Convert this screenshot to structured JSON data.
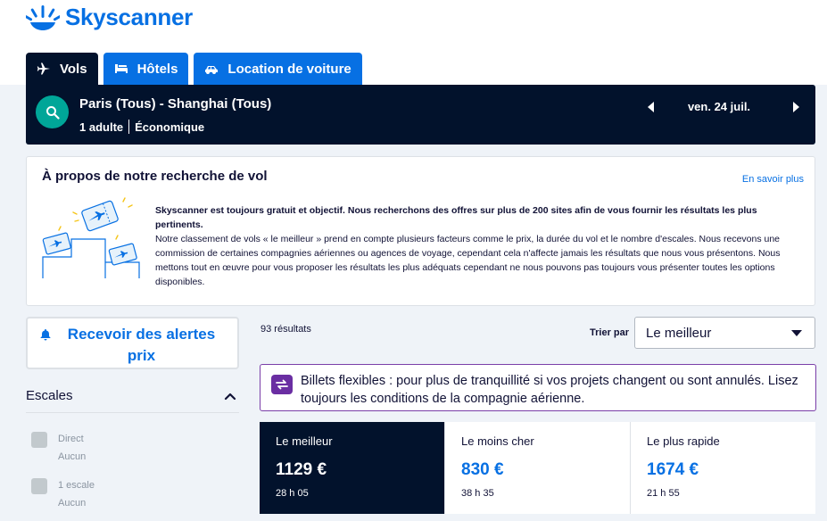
{
  "header": {
    "logo_text": "Skyscanner",
    "tabs": [
      {
        "label": "Vols",
        "icon": "plane-icon",
        "active": true
      },
      {
        "label": "Hôtels",
        "icon": "bed-icon",
        "active": false
      },
      {
        "label": "Location de voiture",
        "icon": "car-icon",
        "active": false
      }
    ]
  },
  "search": {
    "route": "Paris (Tous) - Shanghai (Tous)",
    "passengers": "1 adulte",
    "cabin": "Économique",
    "date": "ven. 24 juil."
  },
  "about": {
    "title": "À propos de notre recherche de vol",
    "link": "En savoir plus",
    "text_bold": "Skyscanner est toujours gratuit et objectif. Nous recherchons des offres sur plus de 200 sites afin de vous fournir les résultats les plus pertinents.",
    "text_body": "Notre classement de vols « le meilleur » prend en compte plusieurs facteurs comme le prix, la durée du vol et le nombre d'escales. Nous recevons une commission de certaines compagnies aériennes ou agences de voyage, cependant cela n'affecte jamais les résultats que nous vous présentons. Nous mettons tout en œuvre pour vous proposer les résultats les plus adéquats cependant ne nous pouvons pas toujours vous présenter toutes les options disponibles."
  },
  "sidebar": {
    "alert_button": "Recevoir des alertes prix",
    "filter_title": "Escales",
    "options": [
      {
        "label": "Direct",
        "sub": "Aucun"
      },
      {
        "label": "1 escale",
        "sub": "Aucun"
      }
    ]
  },
  "results": {
    "count": "93 résultats",
    "sort_label": "Trier par",
    "sort_value": "Le meilleur",
    "flex_banner": "Billets flexibles : pour plus de tranquillité si vos projets changent ou sont annulés. Lisez toujours les conditions de la compagnie aérienne.",
    "sort_tabs": [
      {
        "name": "Le meilleur",
        "price": "1129 €",
        "duration": "28 h 05",
        "active": true
      },
      {
        "name": "Le moins cher",
        "price": "830 €",
        "duration": "38 h 35",
        "active": false
      },
      {
        "name": "Le plus rapide",
        "price": "1674 €",
        "duration": "21 h 55",
        "active": false
      }
    ]
  },
  "colors": {
    "brand_blue": "#0770e3",
    "navy": "#02122c",
    "teal": "#00a698",
    "purple": "#6a2ea2"
  }
}
